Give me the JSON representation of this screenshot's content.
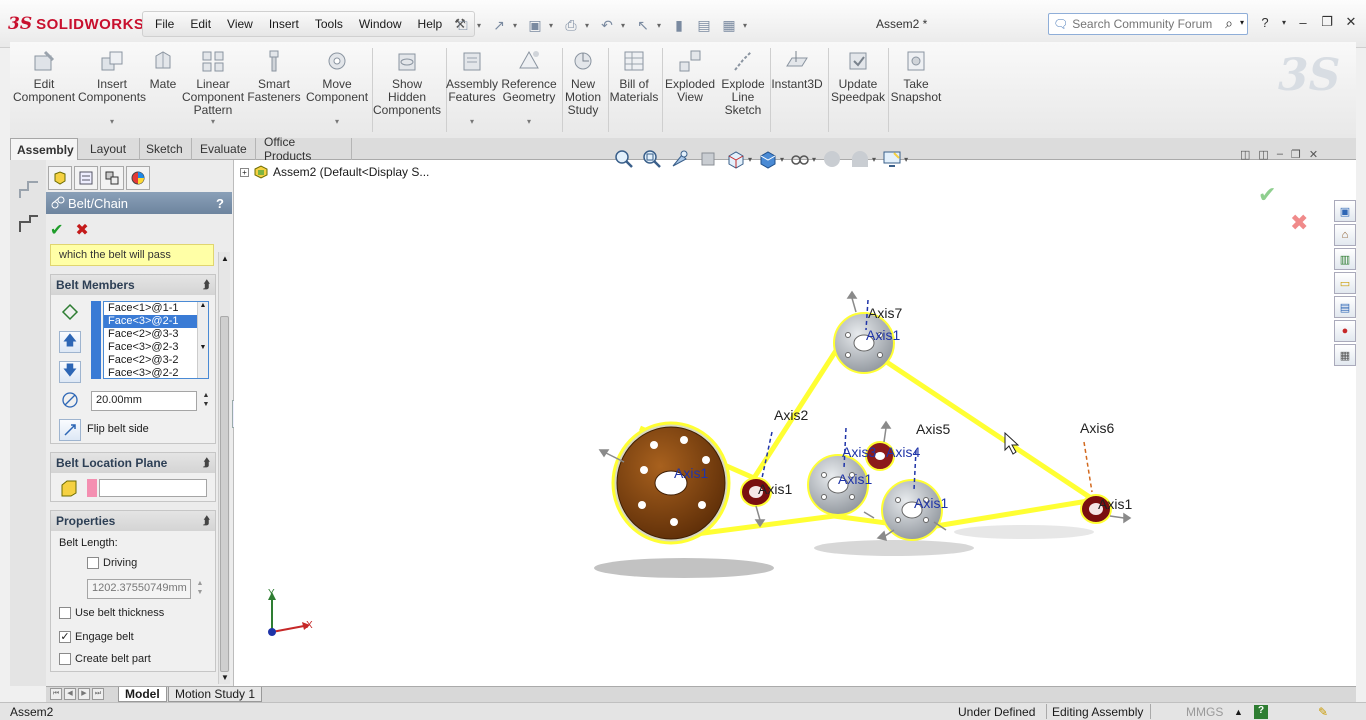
{
  "app": {
    "logo_ds": "3S",
    "logo_text": "SOLIDWORKS",
    "document_title": "Assem2 *"
  },
  "menu": [
    "File",
    "Edit",
    "View",
    "Insert",
    "Tools",
    "Window",
    "Help"
  ],
  "search": {
    "placeholder": "Search Community Forum"
  },
  "command_manager": [
    {
      "label": "Edit\nComponent",
      "icon": "edit-component-icon"
    },
    {
      "label": "Insert\nComponents",
      "icon": "insert-components-icon"
    },
    {
      "label": "Mate",
      "icon": "mate-icon"
    },
    {
      "label": "Linear\nComponent\nPattern",
      "icon": "linear-pattern-icon"
    },
    {
      "label": "Smart\nFasteners",
      "icon": "smart-fasteners-icon"
    },
    {
      "label": "Move\nComponent",
      "icon": "move-component-icon"
    },
    {
      "label": "Show\nHidden\nComponents",
      "icon": "show-hidden-icon"
    },
    {
      "label": "Assembly\nFeatures",
      "icon": "assembly-features-icon"
    },
    {
      "label": "Reference\nGeometry",
      "icon": "reference-geometry-icon"
    },
    {
      "label": "New\nMotion\nStudy",
      "icon": "motion-study-icon"
    },
    {
      "label": "Bill of\nMaterials",
      "icon": "bom-icon"
    },
    {
      "label": "Exploded\nView",
      "icon": "exploded-view-icon"
    },
    {
      "label": "Explode\nLine\nSketch",
      "icon": "explode-line-icon"
    },
    {
      "label": "Instant3D",
      "icon": "instant3d-icon"
    },
    {
      "label": "Update\nSpeedpak",
      "icon": "speedpak-icon"
    },
    {
      "label": "Take\nSnapshot",
      "icon": "snapshot-icon"
    }
  ],
  "tabs": [
    "Assembly",
    "Layout",
    "Sketch",
    "Evaluate",
    "Office Products"
  ],
  "property_manager": {
    "title": "Belt/Chain",
    "help": "?",
    "hint": "which the belt will pass",
    "belt_members": {
      "title": "Belt Members",
      "items": [
        "Face<1>@1-1",
        "Face<3>@2-1",
        "Face<2>@3-3",
        "Face<3>@2-3",
        "Face<2>@3-2",
        "Face<3>@2-2"
      ],
      "selected_index": 1,
      "diameter": "20.00mm",
      "flip_label": "Flip belt side"
    },
    "location_plane": {
      "title": "Belt Location Plane",
      "value": ""
    },
    "properties": {
      "title": "Properties",
      "belt_length_label": "Belt Length:",
      "driving_label": "Driving",
      "driving_checked": false,
      "length_value": "1202.37550749mm",
      "use_thickness_label": "Use belt thickness",
      "use_thickness_checked": false,
      "engage_label": "Engage belt",
      "engage_checked": true,
      "create_part_label": "Create belt part",
      "create_part_checked": false
    }
  },
  "feature_tree": {
    "root": "Assem2  (Default<Display S..."
  },
  "viewport_labels": {
    "axis7": "Axis7",
    "axis2": "Axis2",
    "axis5": "Axis5",
    "axis6": "Axis6",
    "axis1": "Axis1",
    "axis3": "Axis3",
    "axis4": "Axis4",
    "triad_x": "X",
    "triad_y": "Y"
  },
  "bottom_tabs": [
    "Model",
    "Motion Study 1"
  ],
  "status": {
    "doc": "Assem2",
    "state": "Under Defined",
    "mode": "Editing Assembly",
    "units": "MMGS"
  },
  "colors": {
    "belt": "#ffff33",
    "pulley_brown": "#8b4513",
    "pulley_grey": "#b9bec4",
    "idler_red": "#8b0000",
    "accent": "#3a7bd5"
  }
}
